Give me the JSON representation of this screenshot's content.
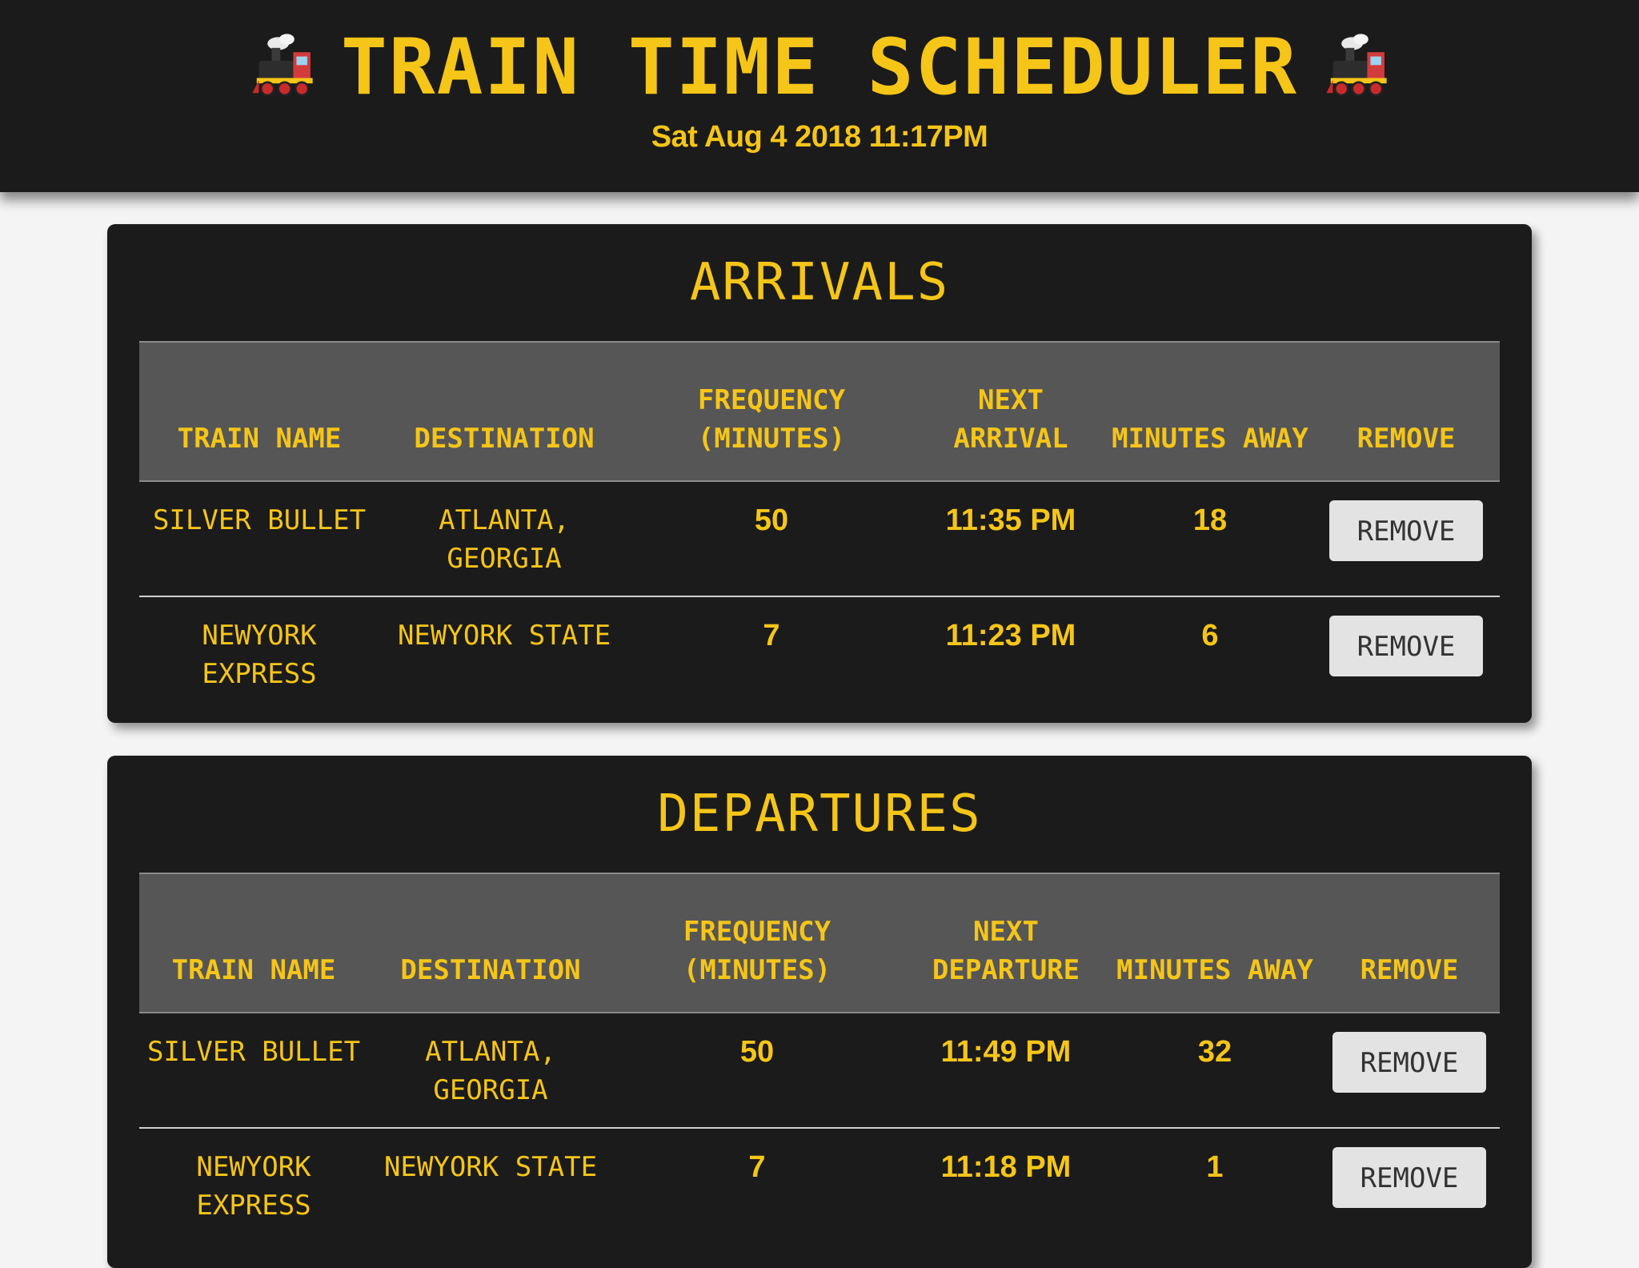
{
  "header": {
    "title": "Train Time Scheduler",
    "left_icon": "steam-locomotive-icon",
    "right_icon": "steam-locomotive-icon",
    "datetime": "Sat Aug 4 2018 11:17PM"
  },
  "colors": {
    "accent": "#f5c518",
    "panel_bg": "#1b1b1b",
    "table_header_bg": "#565656",
    "button_bg": "#e3e3e3",
    "page_bg": "#f4f4f4"
  },
  "arrivals": {
    "title": "Arrivals",
    "columns": {
      "train_name": "Train Name",
      "destination": "Destination",
      "frequency": "Frequency (Minutes)",
      "next": "Next Arrival",
      "minutes_away": "Minutes Away",
      "remove": "Remove"
    },
    "rows": [
      {
        "train_name": "Silver Bullet",
        "destination": "Atlanta, Georgia",
        "frequency": "50",
        "next": "11:35 PM",
        "minutes_away": "18",
        "remove_label": "Remove"
      },
      {
        "train_name": "Newyork Express",
        "destination": "Newyork State",
        "frequency": "7",
        "next": "11:23 PM",
        "minutes_away": "6",
        "remove_label": "Remove"
      }
    ]
  },
  "departures": {
    "title": "Departures",
    "columns": {
      "train_name": "Train Name",
      "destination": "Destination",
      "frequency": "Frequency (Minutes)",
      "next": "Next Departure",
      "minutes_away": "Minutes Away",
      "remove": "Remove"
    },
    "rows": [
      {
        "train_name": "Silver Bullet",
        "destination": "Atlanta, Georgia",
        "frequency": "50",
        "next": "11:49 PM",
        "minutes_away": "32",
        "remove_label": "Remove"
      },
      {
        "train_name": "Newyork Express",
        "destination": "Newyork State",
        "frequency": "7",
        "next": "11:18 PM",
        "minutes_away": "1",
        "remove_label": "Remove"
      }
    ]
  }
}
